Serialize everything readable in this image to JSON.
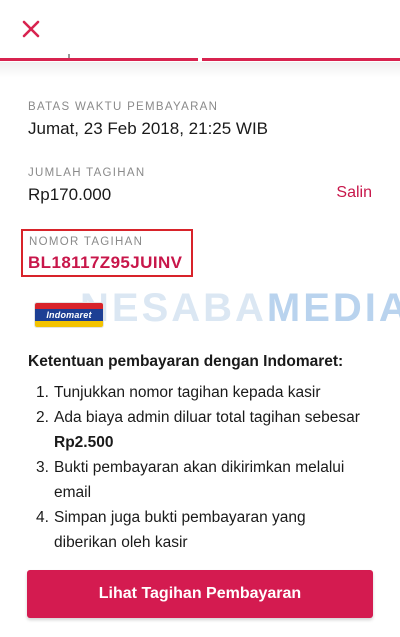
{
  "header": {
    "close_icon": "close-icon",
    "accent_color": "#d8234f"
  },
  "deadline": {
    "label": "BATAS WAKTU PEMBAYARAN",
    "value": "Jumat, 23 Feb 2018, 21:25 WIB"
  },
  "amount": {
    "label": "JUMLAH TAGIHAN",
    "value": "Rp170.000",
    "copy_label": "Salin"
  },
  "bill_number": {
    "label": "NOMOR TAGIHAN",
    "value": "BL18117Z95JUINV",
    "highlight_color": "#d8232a"
  },
  "merchant": {
    "logo_text": "Indomaret"
  },
  "watermark": {
    "part1": "NESABA",
    "part2": "MEDIA"
  },
  "instructions": {
    "title": "Ketentuan pembayaran dengan Indomaret:",
    "steps": [
      {
        "num": "1.",
        "text": "Tunjukkan nomor tagihan kepada kasir"
      },
      {
        "num": "2.",
        "text": "Ada biaya admin diluar total tagihan sebesar",
        "extra": "Rp2.500"
      },
      {
        "num": "3.",
        "text": "Bukti pembayaran akan dikirimkan melalui",
        "extra": "email"
      },
      {
        "num": "4.",
        "text": "Simpan juga bukti pembayaran yang",
        "extra": "diberikan oleh kasir"
      }
    ]
  },
  "cta": {
    "label": "Lihat Tagihan Pembayaran",
    "color": "#d41b50"
  }
}
